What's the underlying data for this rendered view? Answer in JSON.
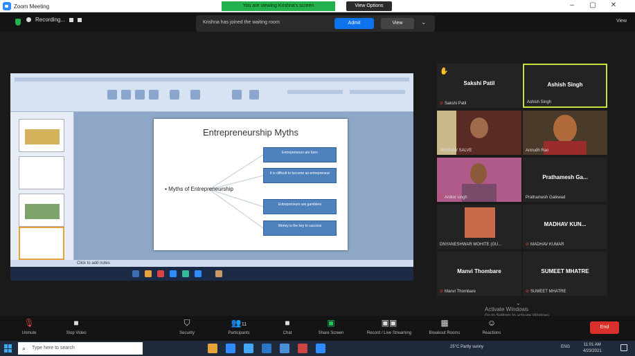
{
  "window": {
    "title": "Zoom Meeting",
    "view_options": "View Options",
    "screen_share_banner": "You are viewing Krishna's screen"
  },
  "topbar": {
    "recording": "Recording...",
    "notice": "Krishna has joined the waiting room",
    "admit": "Admit",
    "see": "View",
    "right_label": "View"
  },
  "slide": {
    "title": "Entrepreneurship Myths",
    "bullet": "Myths of Entrepreneurship",
    "boxes": [
      "Entrepreneurs are born",
      "It is difficult to become an entrepreneur",
      "Entrepreneurs are gamblers",
      "Money is the key to success"
    ],
    "status": "Click to add notes"
  },
  "participants": [
    {
      "name": "Sakshi Patil",
      "label": "Sakshi Patil",
      "video": false,
      "hand": true
    },
    {
      "name": "Ashish Singh",
      "label": "Ashish Singh",
      "video": false,
      "active": true
    },
    {
      "name": "",
      "label": "ABHINAV SALVE",
      "video": true
    },
    {
      "name": "",
      "label": "Anirudh Rao",
      "video": true
    },
    {
      "name": "",
      "label": "Aniket singh",
      "video": true
    },
    {
      "name": "Prathamesh Ga...",
      "label": "Prathamesh Gaikwad",
      "video": false
    },
    {
      "name": "",
      "label": "DNYANESHWAR MOHITE (GU...",
      "video": true
    },
    {
      "name": "MADHAV KUN...",
      "label": "MADHAV KUMAR",
      "video": false
    },
    {
      "name": "Manvi Thombare",
      "label": "Manvi Thombare",
      "video": false
    },
    {
      "name": "SUMEET MHATRE",
      "label": "SUMEET MHATRE",
      "video": false
    }
  ],
  "watermark": {
    "title": "Activate Windows",
    "subtitle": "Go to Settings to activate Windows."
  },
  "toolbar": {
    "unmute": "Unmute",
    "stop_video": "Stop Video",
    "security": "Security",
    "participants": "Participants",
    "participants_count": "11",
    "chat": "Chat",
    "share_screen": "Share Screen",
    "record": "Record / Live Streaming",
    "breakout": "Breakout Rooms",
    "reactions": "Reactions",
    "end": "End"
  },
  "taskbar": {
    "search_placeholder": "Type here to search",
    "weather": "25°C  Partly sunny",
    "time": "11:01 AM",
    "date": "4/23/2021",
    "lang": "ENG"
  }
}
